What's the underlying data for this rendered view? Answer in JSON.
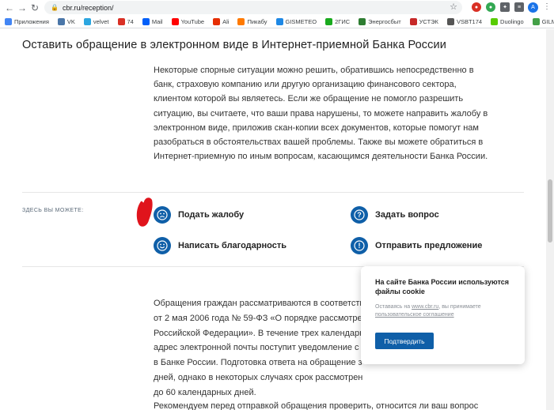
{
  "browser": {
    "url": "cbr.ru/reception/",
    "bookmarks": [
      {
        "label": "Приложения",
        "color": "#4285f4"
      },
      {
        "label": "VK",
        "color": "#4a76a8"
      },
      {
        "label": "velvet",
        "color": "#2ca6e0"
      },
      {
        "label": "74",
        "color": "#d93025"
      },
      {
        "label": "Mail",
        "color": "#005ff9"
      },
      {
        "label": "YouTube",
        "color": "#ff0000"
      },
      {
        "label": "Ali",
        "color": "#e62e04"
      },
      {
        "label": "Пикабу",
        "color": "#ff7a00"
      },
      {
        "label": "GISMETEO",
        "color": "#1e88e5"
      },
      {
        "label": "2ГИС",
        "color": "#19aa1e"
      },
      {
        "label": "Энергосбыт",
        "color": "#2e7d32"
      },
      {
        "label": "УСТЭК",
        "color": "#c62828"
      },
      {
        "label": "VSBT174",
        "color": "#555555"
      },
      {
        "label": "Duolingo",
        "color": "#58cc02"
      },
      {
        "label": "GILMON",
        "color": "#43a047"
      }
    ],
    "profile_initial": "A"
  },
  "page": {
    "title": "Оставить обращение в электронном виде в Интернет-приемной Банка России",
    "intro": "Некоторые спорные ситуации можно решить, обратившись непосредственно в банк, страховую компанию или другую организацию финансового сектора, клиентом которой вы являетесь. Если же обращение не помогло разрешить ситуацию, вы считаете, что ваши права нарушены, то можете направить жалобу в электронном виде, приложив скан-копии всех документов, которые помогут нам разобраться в обстоятельствах вашей проблемы. Также вы можете обратиться в Интернет-приемную по иным вопросам, касающимся деятельности Банка России.",
    "section_label": "ЗДЕСЬ ВЫ МОЖЕТЕ:",
    "actions": [
      {
        "label": "Подать жалобу",
        "icon": "sad-face-icon"
      },
      {
        "label": "Задать вопрос",
        "icon": "question-icon"
      },
      {
        "label": "Написать благодарность",
        "icon": "smile-icon"
      },
      {
        "label": "Отправить предложение",
        "icon": "info-icon"
      }
    ],
    "body_lines": [
      "Обращения граждан рассматриваются в соответств",
      "от 2 мая 2006 года № 59-ФЗ «О порядке рассмотрен",
      "Российской Федерации». В течение трех календарн",
      "адрес электронной почты поступит уведомление с",
      "в Банке России. Подготовка ответа на обращение з",
      "дней, однако в некоторых случаях срок рассмотрен",
      "до 60 календарных дней."
    ],
    "body_last": "Рекомендуем перед отправкой обращения проверить, относится ли ваш вопрос"
  },
  "cookie": {
    "title": "На сайте Банка России используются файлы cookie",
    "text_before": "Оставаясь на ",
    "site_link": "www.cbr.ru",
    "text_after": ", вы принимаете ",
    "agreement_link": "пользовательское соглашение",
    "button": "Подтвердить"
  },
  "colors": {
    "accent": "#0f5fa8",
    "annotation": "#e0141c"
  }
}
